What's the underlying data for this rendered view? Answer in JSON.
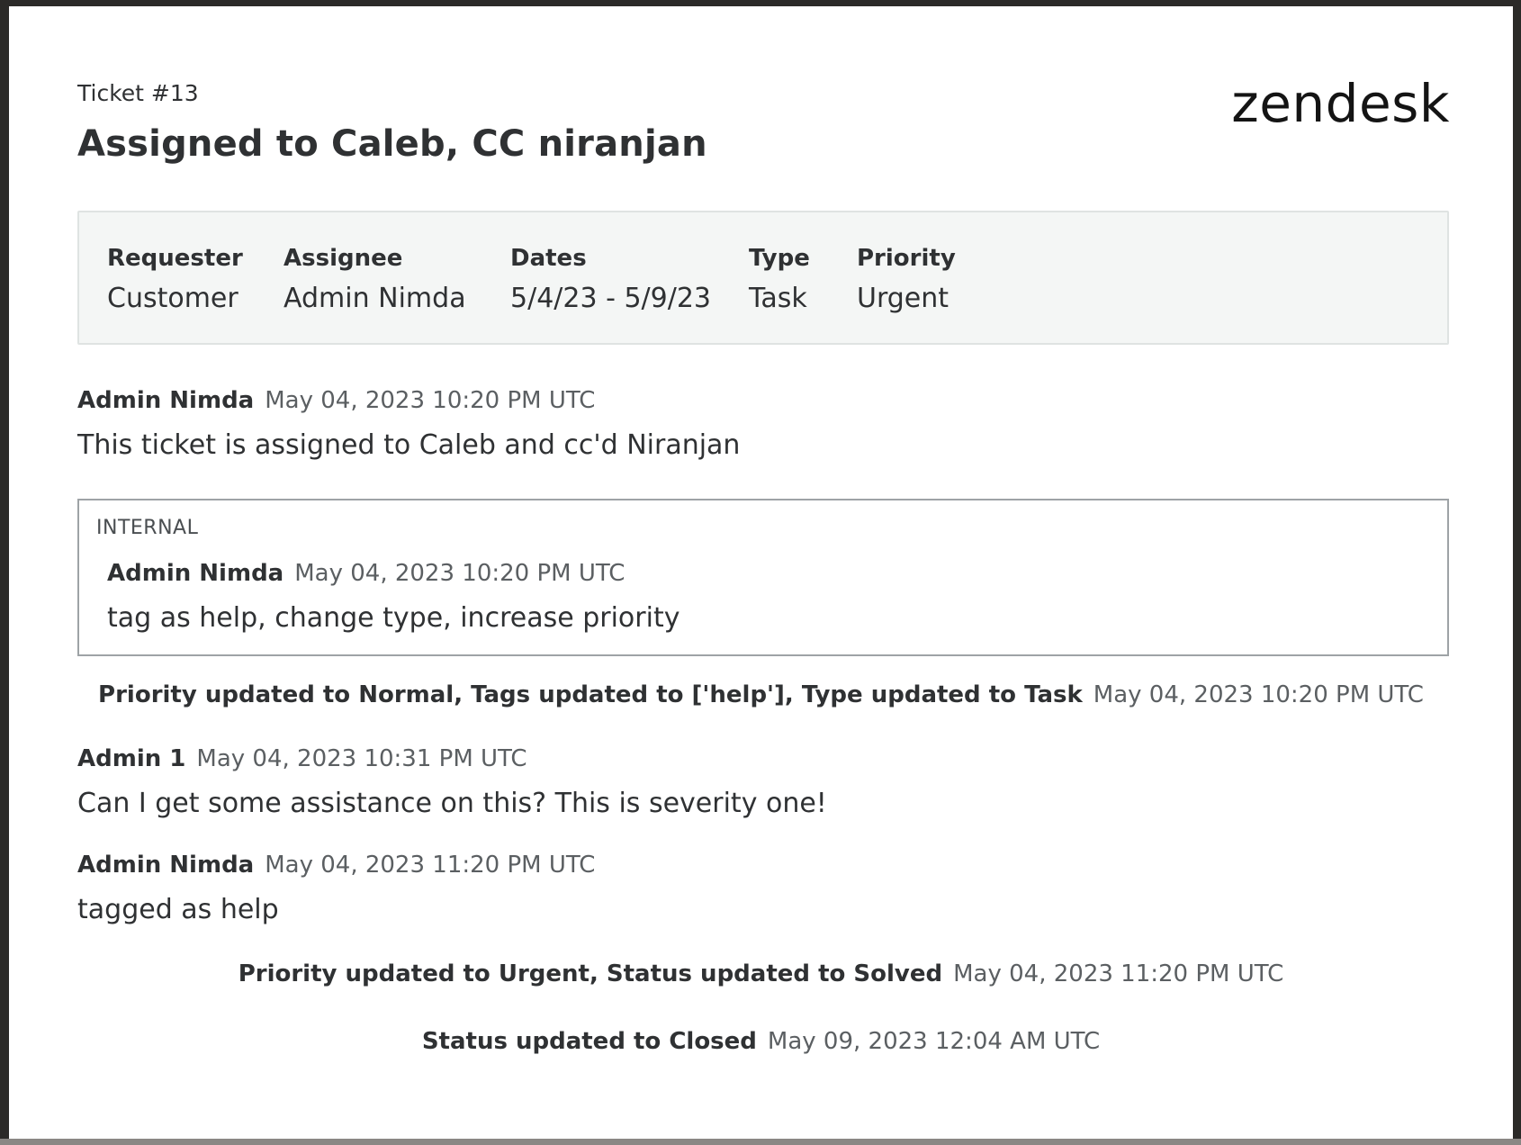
{
  "ticket": {
    "number": "Ticket #13",
    "title": "Assigned to Caleb, CC niranjan"
  },
  "brand": {
    "logo": "zendesk"
  },
  "summary": {
    "requester_label": "Requester",
    "requester": "Customer",
    "assignee_label": "Assignee",
    "assignee": "Admin Nimda",
    "dates_label": "Dates",
    "dates": "5/4/23 - 5/9/23",
    "type_label": "Type",
    "type": "Task",
    "priority_label": "Priority",
    "priority": "Urgent"
  },
  "timeline": {
    "comment1": {
      "author": "Admin Nimda",
      "time": "May 04, 2023 10:20 PM UTC",
      "body": "This ticket is assigned to Caleb and cc'd Niranjan"
    },
    "internal": {
      "label": "INTERNAL",
      "author": "Admin Nimda",
      "time": "May 04, 2023 10:20 PM UTC",
      "body": "tag as help, change type, increase priority"
    },
    "event1": {
      "desc": "Priority updated to Normal, Tags updated to ['help'], Type updated to Task",
      "time": "May 04, 2023 10:20 PM UTC"
    },
    "comment2": {
      "author": "Admin 1",
      "time": "May 04, 2023 10:31 PM UTC",
      "body": "Can I get some assistance on this? This is severity one!"
    },
    "comment3": {
      "author": "Admin Nimda",
      "time": "May 04, 2023 11:20 PM UTC",
      "body": "tagged as help"
    },
    "event2": {
      "desc": "Priority updated to Urgent, Status updated to Solved",
      "time": "May 04, 2023 11:20 PM UTC"
    },
    "event3": {
      "desc": "Status updated to Closed",
      "time": "May 09, 2023 12:04 AM UTC"
    }
  }
}
